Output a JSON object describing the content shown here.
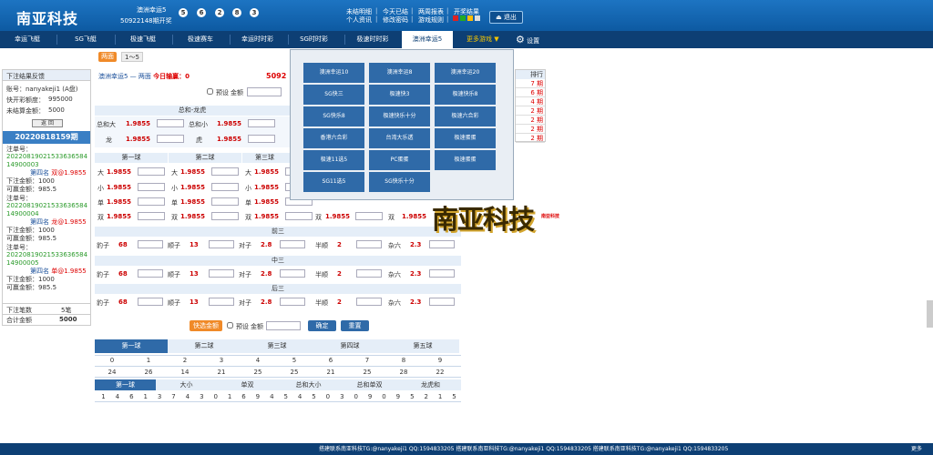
{
  "header": {
    "logo": "南亚科技",
    "lottery_name": "澳洲幸运5",
    "draw_info": "50922148期开奖",
    "balls": [
      "5",
      "6",
      "2",
      "8",
      "3"
    ],
    "links_row1": [
      "未结明细",
      "今天已结",
      "两周报表",
      "开奖结果"
    ],
    "links_row2": [
      "个人资讯",
      "修改密码",
      "游戏规则"
    ],
    "logout": "退出",
    "colors": [
      "#d22",
      "#2a2",
      "#fb0",
      "#ddd"
    ]
  },
  "nav": {
    "items": [
      "幸运飞艇",
      "SG飞艇",
      "极速飞艇",
      "极速赛车",
      "幸运时时彩",
      "SG时时彩",
      "极速时时彩",
      "澳洲幸运5"
    ],
    "more": "更多游戏 ▼",
    "settings": "设置"
  },
  "tabs": {
    "double": "两面",
    "one_five": "1～5"
  },
  "left": {
    "header": "下注结果反馈",
    "account": "账号：nanyakeji1 (A盘)",
    "quota_label": "快开彩额度：",
    "quota": "995000",
    "unsettled_label": "未结算金额：",
    "unsettled": "5000",
    "return": "返 回",
    "period": "20220818159期",
    "bets": [
      {
        "no": "2022081902153363658414900003",
        "desc": "第四名",
        "choice": "双",
        "odds": "@1.9855",
        "amount_label": "下注金额：",
        "amount": "1000",
        "win_label": "可赢金额：",
        "win": "985.5"
      },
      {
        "no": "2022081902153363658414900004",
        "desc": "第四名",
        "choice": "龙",
        "odds": "@1.9855",
        "amount_label": "下注金额：",
        "amount": "1000",
        "win_label": "可赢金额：",
        "win": "985.5"
      },
      {
        "no": "2022081902153363658414900005",
        "desc": "第四名",
        "choice": "单",
        "odds": "@1.9855",
        "amount_label": "下注金额：",
        "amount": "1000",
        "win_label": "可赢金额：",
        "win": "985.5"
      }
    ],
    "bet_no_label": "注单号：",
    "total_count_label": "下注笔数",
    "total_count": "5笔",
    "total_amount_label": "合计金额",
    "total_amount": "5000"
  },
  "main": {
    "title_left": "澳洲幸运5 — 两面",
    "today_label": "今日输赢：",
    "today_value": "0",
    "period_partial": "5092",
    "preset_label": "预设",
    "amount_label": "金额",
    "sum_header": "总和-龙虎",
    "sum_rows": [
      {
        "a": "总和大",
        "ao": "1.9855",
        "b": "总和小",
        "bo": "1.9855"
      },
      {
        "a": "龙",
        "ao": "1.9855",
        "b": "虎",
        "bo": "1.9855"
      }
    ],
    "ball_headers": [
      "第一球",
      "第二球",
      "第三球"
    ],
    "ball_rows": [
      "大",
      "小",
      "单",
      "双"
    ],
    "odds": "1.9855",
    "extra_double": "双",
    "groups": [
      "前三",
      "中三",
      "后三"
    ],
    "group_items": [
      {
        "label": "豹子",
        "odds": "68"
      },
      {
        "label": "顺子",
        "odds": "13"
      },
      {
        "label": "对子",
        "odds": "2.8"
      },
      {
        "label": "半顺",
        "odds": "2"
      },
      {
        "label": "杂六",
        "odds": "2.3"
      }
    ],
    "quick_amount": "快选金额",
    "confirm": "确定",
    "reset": "重置"
  },
  "popup": {
    "items": [
      "澳洲幸运10",
      "澳洲幸运8",
      "澳洲幸运20",
      "SG快三",
      "极速快3",
      "极速快乐8",
      "SG快乐8",
      "极速快乐十分",
      "极速六合彩",
      "香港六合彩",
      "台湾大乐透",
      "极速蛋蛋",
      "极速11选5",
      "PC蛋蛋",
      "极速蛋蛋",
      "SG11选5",
      "SG快乐十分"
    ]
  },
  "rank": {
    "title": "排行",
    "values": [
      "7 期",
      "6 期",
      "4 期",
      "2 期",
      "2 期",
      "2 期",
      "2 期"
    ]
  },
  "brand": {
    "name": "南亚科技",
    "sub": "南亚科技"
  },
  "stats": {
    "tabs": [
      "第一球",
      "第二球",
      "第三球",
      "第四球",
      "第五球"
    ],
    "digits": [
      "0",
      "1",
      "2",
      "3",
      "4",
      "5",
      "6",
      "7",
      "8",
      "9"
    ],
    "counts": [
      "24",
      "26",
      "14",
      "21",
      "25",
      "25",
      "21",
      "25",
      "28",
      "22"
    ],
    "tabs2": [
      "第一球",
      "大小",
      "单双",
      "总和大小",
      "总和单双",
      "龙虎和"
    ],
    "sequence": [
      "1",
      "4",
      "6",
      "1",
      "3",
      "7",
      "4",
      "3",
      "0",
      "1",
      "6",
      "9",
      "4",
      "5",
      "4",
      "5",
      "0",
      "3",
      "0",
      "9",
      "0",
      "9",
      "5",
      "2",
      "1",
      "5"
    ]
  },
  "footer": {
    "text": "搭建联系南亚科技TG:@nanyakeji1 QQ:1594833205 搭建联系南亚科技TG:@nanyakeji1 QQ:1594833205 搭建联系南亚科技TG:@nanyakeji1 QQ:1594833205",
    "more": "更多"
  }
}
